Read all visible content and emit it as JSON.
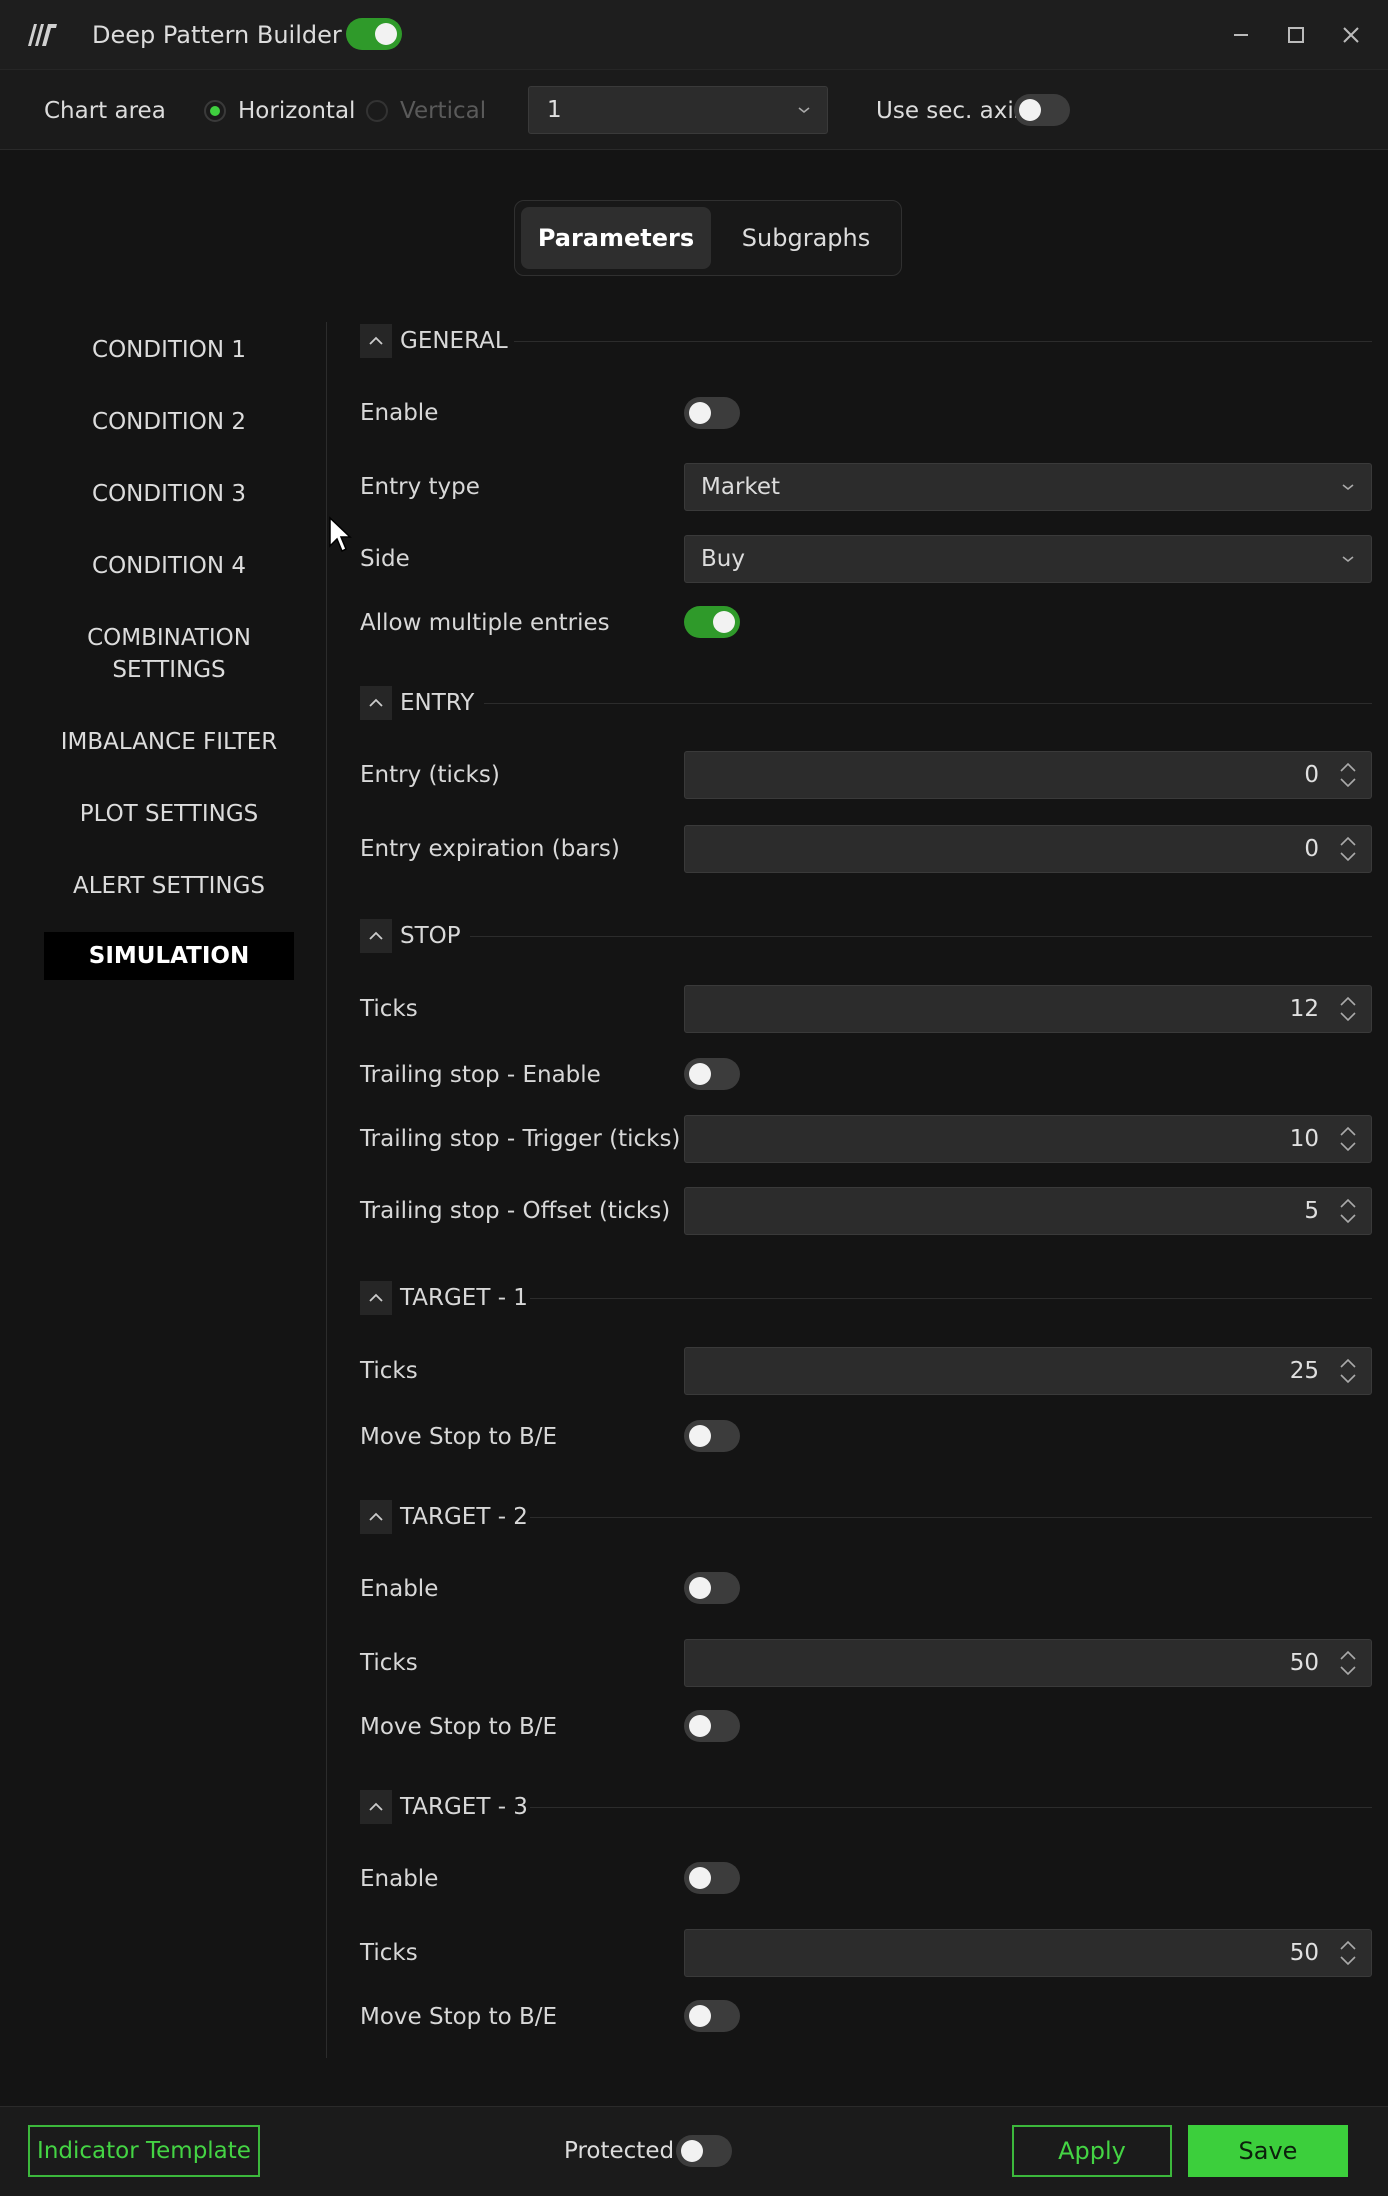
{
  "window": {
    "title": "Deep Pattern Builder",
    "enabled": true,
    "controls": [
      "minimize-icon",
      "maximize-icon",
      "close-icon"
    ]
  },
  "chart_area": {
    "label": "Chart area",
    "options": [
      {
        "label": "Horizontal",
        "selected": true
      },
      {
        "label": "Vertical",
        "selected": false
      }
    ],
    "selected_value": "1",
    "sec_axis_label": "Use sec. axis",
    "sec_axis_on": false
  },
  "tabs": [
    {
      "label": "Parameters",
      "active": true
    },
    {
      "label": "Subgraphs",
      "active": false
    }
  ],
  "sidebar": {
    "items": [
      {
        "label": "CONDITION 1"
      },
      {
        "label": "CONDITION 2"
      },
      {
        "label": "CONDITION 3"
      },
      {
        "label": "CONDITION 4"
      },
      {
        "label": "COMBINATION\nSETTINGS"
      },
      {
        "label": "IMBALANCE FILTER"
      },
      {
        "label": "PLOT SETTINGS"
      },
      {
        "label": "ALERT SETTINGS"
      },
      {
        "label": "SIMULATION",
        "active": true
      }
    ]
  },
  "sections": {
    "general": {
      "title": "GENERAL",
      "enable_label": "Enable",
      "enable_on": false,
      "entry_type_label": "Entry type",
      "entry_type_value": "Market",
      "side_label": "Side",
      "side_value": "Buy",
      "multiple_label": "Allow multiple entries",
      "multiple_on": true
    },
    "entry": {
      "title": "ENTRY",
      "ticks_label": "Entry (ticks)",
      "ticks_value": "0",
      "expiration_label": "Entry expiration (bars)",
      "expiration_value": "0"
    },
    "stop": {
      "title": "STOP",
      "ticks_label": "Ticks",
      "ticks_value": "12",
      "trailing_enable_label": "Trailing stop - Enable",
      "trailing_enable_on": false,
      "trailing_trigger_label": "Trailing stop - Trigger (ticks)",
      "trailing_trigger_value": "10",
      "trailing_offset_label": "Trailing stop - Offset (ticks)",
      "trailing_offset_value": "5"
    },
    "target1": {
      "title": "TARGET - 1",
      "ticks_label": "Ticks",
      "ticks_value": "25",
      "move_stop_label": "Move Stop to B/E",
      "move_stop_on": false
    },
    "target2": {
      "title": "TARGET - 2",
      "enable_label": "Enable",
      "enable_on": false,
      "ticks_label": "Ticks",
      "ticks_value": "50",
      "move_stop_label": "Move Stop to B/E",
      "move_stop_on": false
    },
    "target3": {
      "title": "TARGET - 3",
      "enable_label": "Enable",
      "enable_on": false,
      "ticks_label": "Ticks",
      "ticks_value": "50",
      "move_stop_label": "Move Stop to B/E",
      "move_stop_on": false
    }
  },
  "footer": {
    "template_label": "Indicator Template",
    "protected_label": "Protected",
    "protected_on": false,
    "apply_label": "Apply",
    "save_label": "Save"
  },
  "colors": {
    "accent": "#3ccf3c",
    "toggle_on": "#2f9a2a",
    "background": "#141414"
  }
}
